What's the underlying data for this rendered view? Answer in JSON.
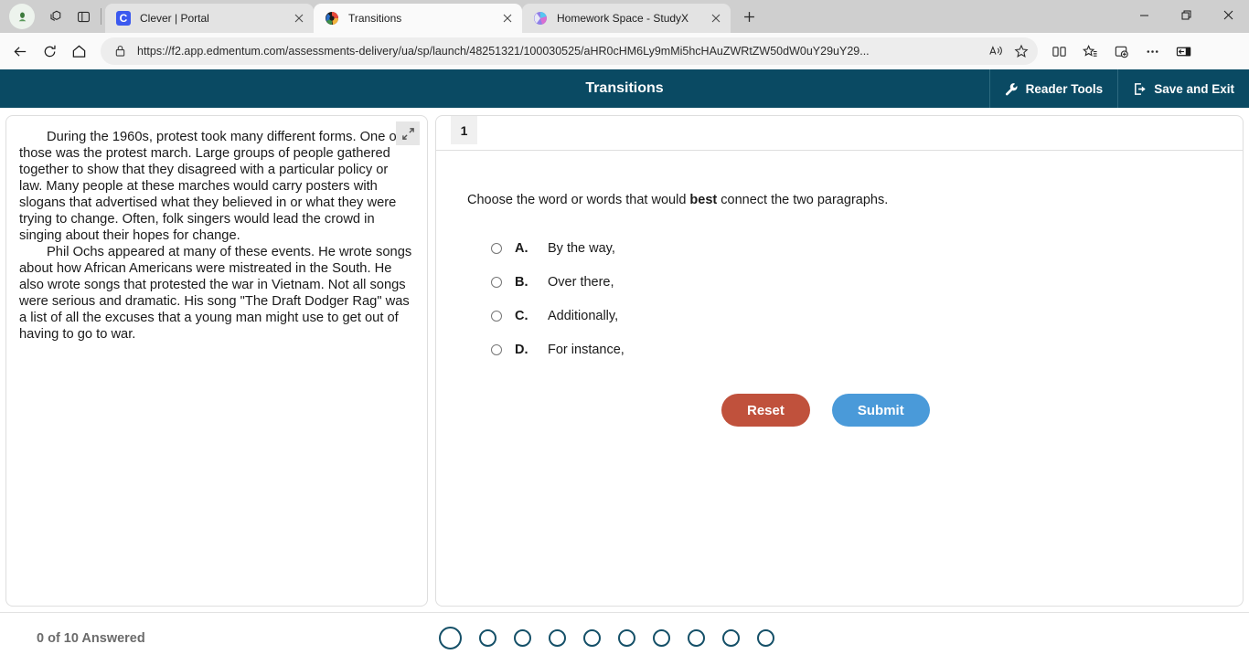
{
  "browser": {
    "tabs": [
      {
        "title": "Clever | Portal",
        "favicon": "clever-c-icon",
        "active": false
      },
      {
        "title": "Transitions",
        "favicon": "edmentum-icon",
        "active": true
      },
      {
        "title": "Homework Space - StudyX",
        "favicon": "studyx-icon",
        "active": false
      }
    ],
    "url_prefix": "https://",
    "url_domain": "f2.app.edmentum.com",
    "url_path": "/assessments-delivery/ua/sp/launch/48251321/100030525/aHR0cHM6Ly9mMi5hcHAuZWRtZW50dW0uY29uY29...",
    "url_full": "https://f2.app.edmentum.com/assessments-delivery/ua/sp/launch/48251321/100030525/aHR0cHM6Ly9mMi5hcHAuZWRtZW50dW0uY29uY29...",
    "toolbar_icons": [
      "back-icon",
      "refresh-icon",
      "home-icon",
      "lock-icon",
      "read-aloud-icon",
      "favorite-star-icon",
      "split-screen-icon",
      "favorites-list-icon",
      "collections-icon",
      "more-options-icon",
      "sidebar-toggle-icon"
    ],
    "window_controls": [
      "minimize-icon",
      "restore-icon",
      "close-icon"
    ],
    "new_tab_label": "+"
  },
  "header": {
    "title": "Transitions",
    "reader_tools_label": "Reader Tools",
    "save_exit_label": "Save and Exit",
    "bg_color": "#0a4a63"
  },
  "passage": {
    "paragraphs": [
      "During the 1960s, protest took many different forms. One of those was the protest march. Large groups of people gathered together to show that they disagreed with a particular policy or law. Many people at these marches would carry posters with slogans that advertised what they believed in or what they were trying to change. Often, folk singers would lead the crowd in singing about their hopes for change.",
      "Phil Ochs appeared at many of these events. He wrote songs about how African Americans were mistreated in the South. He also wrote songs that protested the war in Vietnam. Not all songs were serious and dramatic. His song \"The Draft Dodger Rag\" was a list of all the excuses that a young man might use to get out of having to go to war."
    ]
  },
  "question": {
    "tab_number": "1",
    "prompt_before": "Choose the word or words that would ",
    "prompt_emphasis": "best",
    "prompt_after": " connect the two paragraphs.",
    "choices": [
      {
        "letter": "A.",
        "text": "By the way,",
        "selected": false
      },
      {
        "letter": "B.",
        "text": "Over there,",
        "selected": false
      },
      {
        "letter": "C.",
        "text": "Additionally,",
        "selected": false
      },
      {
        "letter": "D.",
        "text": "For instance,",
        "selected": false
      }
    ],
    "reset_label": "Reset",
    "submit_label": "Submit",
    "reset_color": "#c0513c",
    "submit_color": "#4a9ad9"
  },
  "footer": {
    "answered_label": "0 of 10 Answered",
    "total_questions": 10,
    "current_question": 1,
    "dot_color": "#155068"
  }
}
